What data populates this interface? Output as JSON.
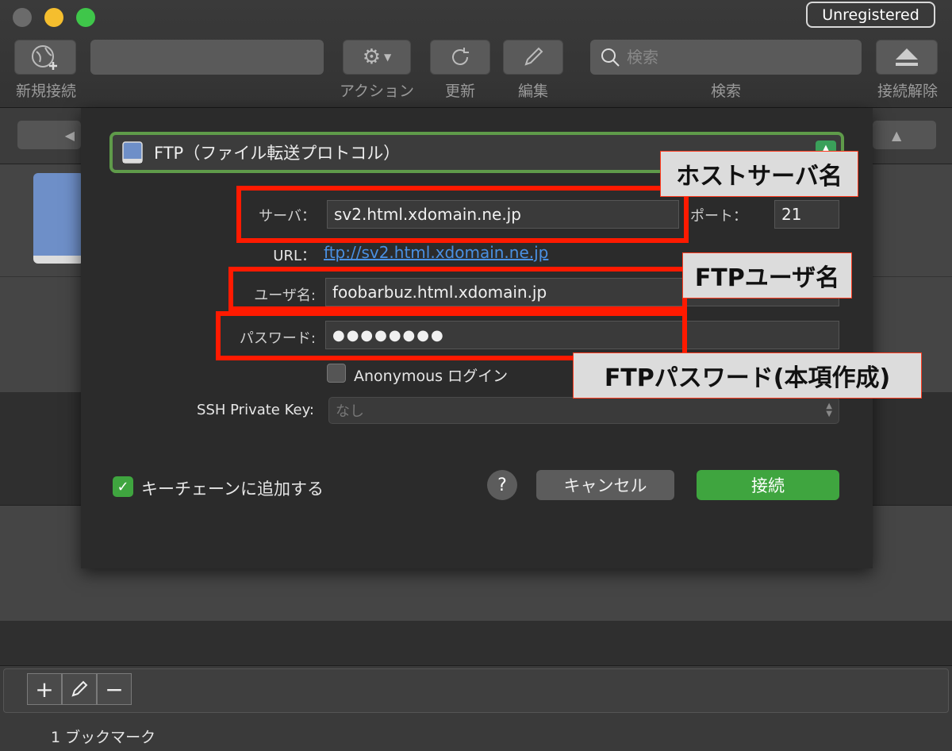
{
  "toolbar": {
    "unregistered": "Unregistered",
    "new_connection": "新規接続",
    "action": "アクション",
    "refresh": "更新",
    "edit": "編集",
    "search_label": "検索",
    "search_placeholder": "検索",
    "disconnect": "接続解除"
  },
  "sheet": {
    "protocol": "FTP（ファイル転送プロトコル）",
    "server_label": "サーバ：",
    "server_value": "sv2.html.xdomain.ne.jp",
    "port_label": "ポート：",
    "port_value": "21",
    "url_label": "URL：",
    "url_value": "ftp://sv2.html.xdomain.ne.jp",
    "user_label": "ユーザ名:",
    "user_value": "foobarbuz.html.xdomain.jp",
    "password_label": "パスワード:",
    "password_value": "●●●●●●●●",
    "anonymous_label": "Anonymous ログイン",
    "ssh_label": "SSH Private Key:",
    "ssh_value": "なし",
    "keychain_label": "キーチェーンに追加する",
    "help": "?",
    "cancel": "キャンセル",
    "connect": "接続"
  },
  "annotations": {
    "host": "ホストサーバ名",
    "ftp_user": "FTPユーザ名",
    "ftp_password": "FTPパスワード(本項作成)"
  },
  "footer": {
    "bookmark_count": "1 ブックマーク"
  },
  "colors": {
    "accent_green": "#3fa53f",
    "link_blue": "#4a90e2",
    "annotation_red": "#ff1a00"
  }
}
